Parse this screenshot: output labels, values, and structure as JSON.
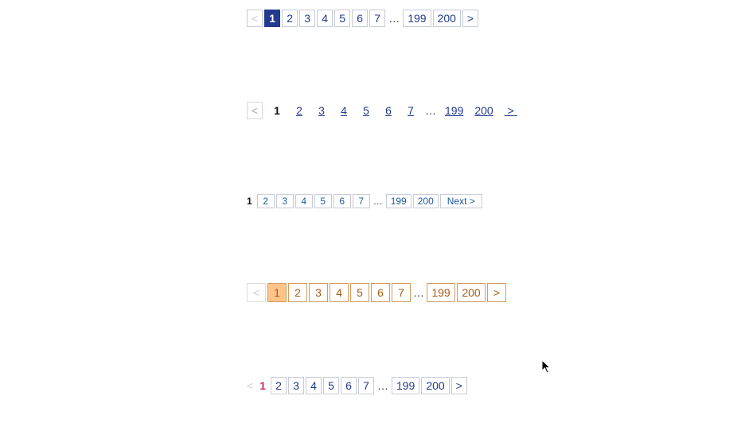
{
  "paginations": [
    {
      "style": "s1",
      "prev": "<",
      "next": ">",
      "active": "1",
      "pages": [
        "2",
        "3",
        "4",
        "5",
        "6",
        "7"
      ],
      "ellipsis": "…",
      "tail": [
        "199",
        "200"
      ],
      "prev_disabled": true
    },
    {
      "style": "s2",
      "prev": "<",
      "next": ">",
      "active": "1",
      "pages": [
        "2",
        "3",
        "4",
        "5",
        "6",
        "7"
      ],
      "ellipsis": "…",
      "tail": [
        "199",
        "200"
      ],
      "prev_disabled": true
    },
    {
      "style": "s3",
      "next": "Next >",
      "active": "1",
      "pages": [
        "2",
        "3",
        "4",
        "5",
        "6",
        "7"
      ],
      "ellipsis": "…",
      "tail": [
        "199",
        "200"
      ]
    },
    {
      "style": "s4",
      "prev": "<",
      "next": ">",
      "active": "1",
      "pages": [
        "2",
        "3",
        "4",
        "5",
        "6",
        "7"
      ],
      "ellipsis": "…",
      "tail": [
        "199",
        "200"
      ],
      "prev_disabled": true
    },
    {
      "style": "s5",
      "prev": "<",
      "next": ">",
      "active": "1",
      "pages": [
        "2",
        "3",
        "4",
        "5",
        "6",
        "7"
      ],
      "ellipsis": "…",
      "tail": [
        "199",
        "200"
      ],
      "prev_disabled": true
    }
  ]
}
